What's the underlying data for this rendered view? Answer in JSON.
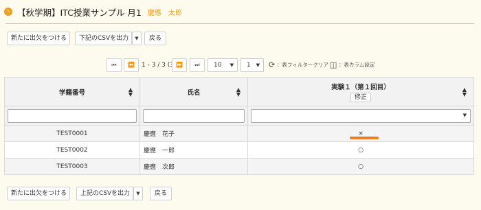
{
  "header": {
    "icon": "chevron-right-circle-icon",
    "title": "【秋学期】ITC授業サンプル 月1",
    "user": "慶應　太郎"
  },
  "toolbar_top": {
    "add_attendance": "新たに出欠をつける",
    "export_csv": "下記のCSVを出力",
    "back": "戻る"
  },
  "pager": {
    "range": "1 - 3 / 3 (3)",
    "page_size": "10",
    "page": "1",
    "filter_clear": "：表フィルタークリア",
    "column_settings": "：表カラム設定"
  },
  "table": {
    "columns": [
      "学籍番号",
      "氏名",
      "実験１（第１回目）"
    ],
    "edit_label": "修正",
    "rows": [
      {
        "id": "TEST0001",
        "name": "慶應　花子",
        "mark": "×"
      },
      {
        "id": "TEST0002",
        "name": "慶應　一郎",
        "mark": "○"
      },
      {
        "id": "TEST0003",
        "name": "慶應　次郎",
        "mark": "○"
      }
    ]
  },
  "toolbar_bottom": {
    "add_attendance": "新たに出欠をつける",
    "export_csv": "上記のCSVを出力",
    "back": "戻る"
  },
  "colors": {
    "accent": "#f0a020",
    "highlight": "#f07d1e",
    "background": "#fdfaee"
  }
}
